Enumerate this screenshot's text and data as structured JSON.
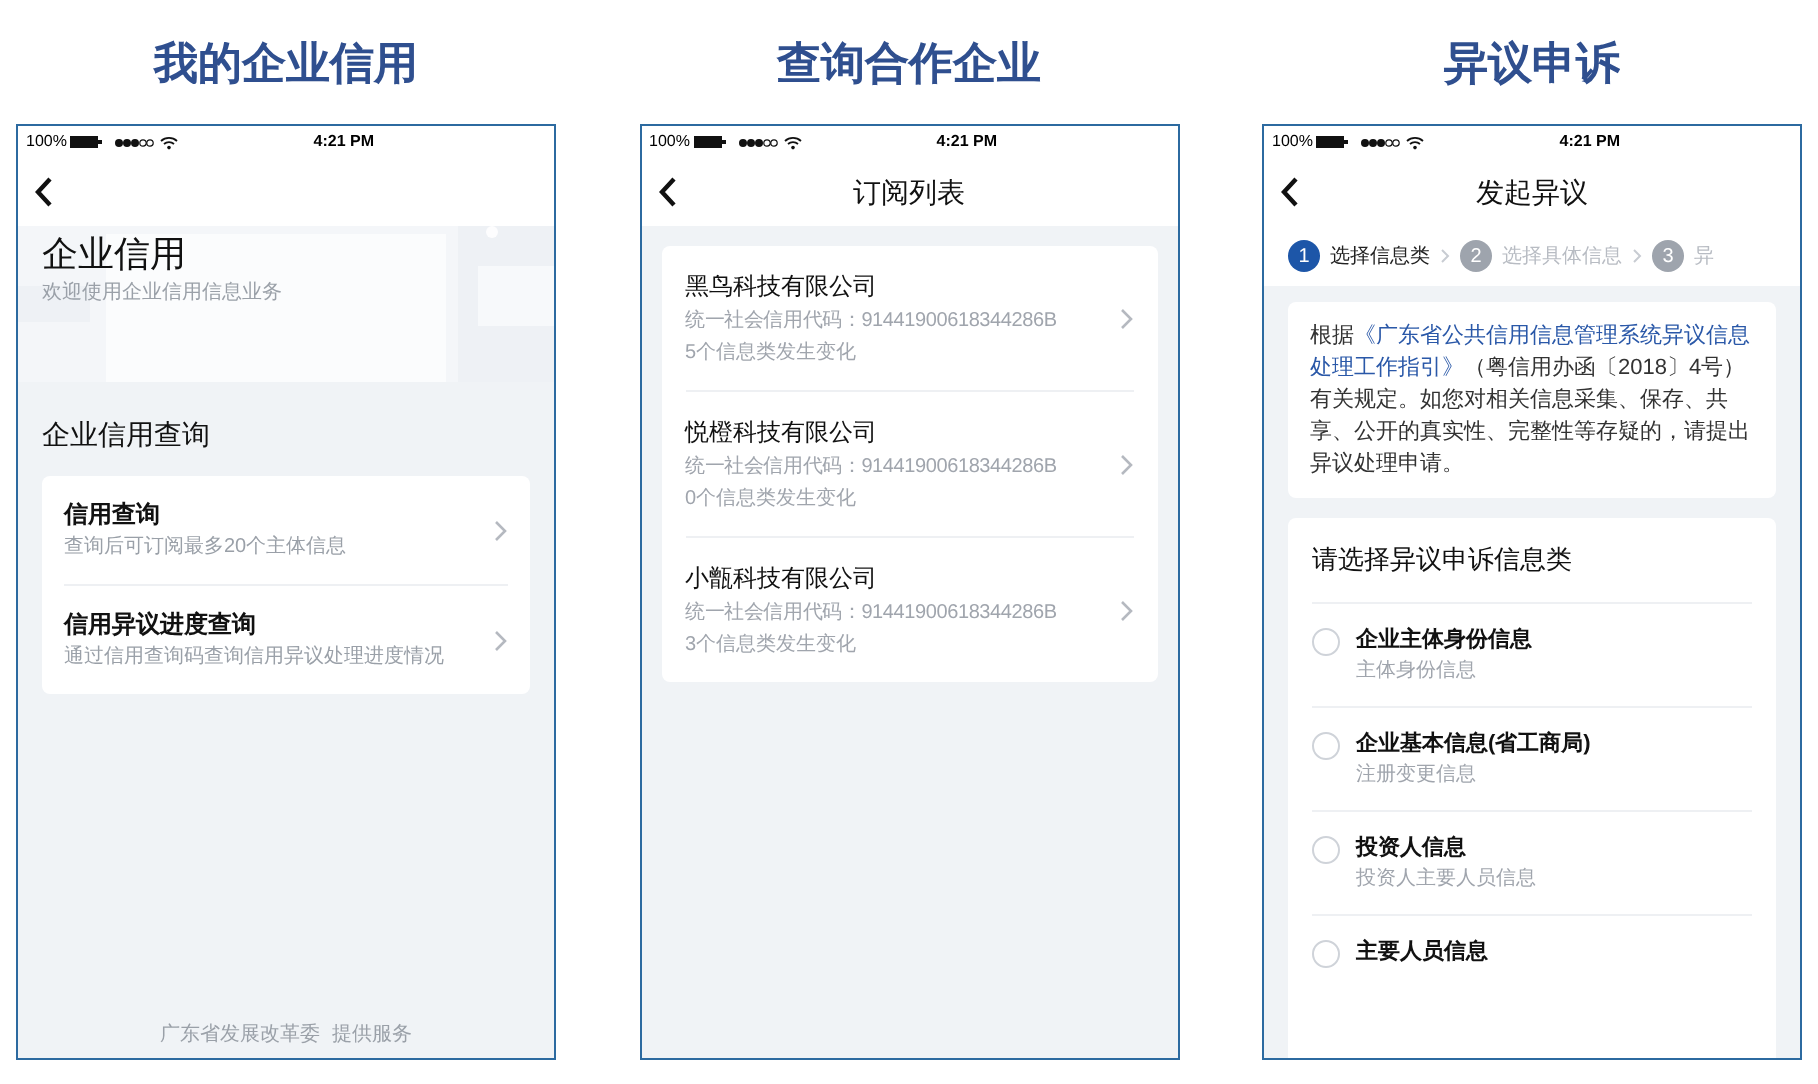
{
  "panels": [
    {
      "heading": "我的企业信用",
      "kind": "home",
      "status_bar": {
        "battery": "100%",
        "time": "4:21 PM"
      },
      "title": "企业信用",
      "subtitle": "欢迎使用企业信用信息业务",
      "section_title": "企业信用查询",
      "items": [
        {
          "title": "信用查询",
          "desc": "查询后可订阅最多20个主体信息"
        },
        {
          "title": "信用异议进度查询",
          "desc": "通过信用查询码查询信用异议处理进度情况"
        }
      ],
      "footer": "广东省发展改革委  提供服务"
    },
    {
      "heading": "查询合作企业",
      "kind": "list",
      "status_bar": {
        "battery": "100%",
        "time": "4:21 PM"
      },
      "nav_title": "订阅列表",
      "companies": [
        {
          "name": "黑鸟科技有限公司",
          "code": "统一社会信用代码：91441900618344286B",
          "changes": "5个信息类发生变化"
        },
        {
          "name": "悦橙科技有限公司",
          "code": "统一社会信用代码：91441900618344286B",
          "changes": "0个信息类发生变化"
        },
        {
          "name": "小甑科技有限公司",
          "code": "统一社会信用代码：91441900618344286B",
          "changes": "3个信息类发生变化"
        }
      ]
    },
    {
      "heading": "异议申诉",
      "kind": "objection",
      "status_bar": {
        "battery": "100%",
        "time": "4:21 PM"
      },
      "nav_title": "发起异议",
      "steps": [
        {
          "number": "1",
          "label": "选择信息类",
          "selected": true
        },
        {
          "number": "2",
          "label": "选择具体信息",
          "selected": false
        },
        {
          "number": "3",
          "label": "异",
          "selected": false
        }
      ],
      "notice": [
        {
          "text": "根据",
          "kind": "plain"
        },
        {
          "text": "《广东省公共信用信息管理系统异议信息处理工作指引》",
          "kind": "highlight"
        },
        {
          "text": "（粤信用办函〔2018〕4号）有关规定。如您对相关信息采集、保存、共享、公开的真实性、完整性等存疑的，请提出异议处理申请。",
          "kind": "plain"
        }
      ],
      "options_title": "请选择异议申诉信息类",
      "options": [
        {
          "title": "企业主体身份信息",
          "desc": "主体身份信息",
          "checked": false
        },
        {
          "title": "企业基本信息(省工商局)",
          "desc": "注册变更信息",
          "checked": false
        },
        {
          "title": "投资人信息",
          "desc": "投资人主要人员信息",
          "checked": false
        },
        {
          "title": "主要人员信息",
          "checked": false
        }
      ]
    }
  ]
}
